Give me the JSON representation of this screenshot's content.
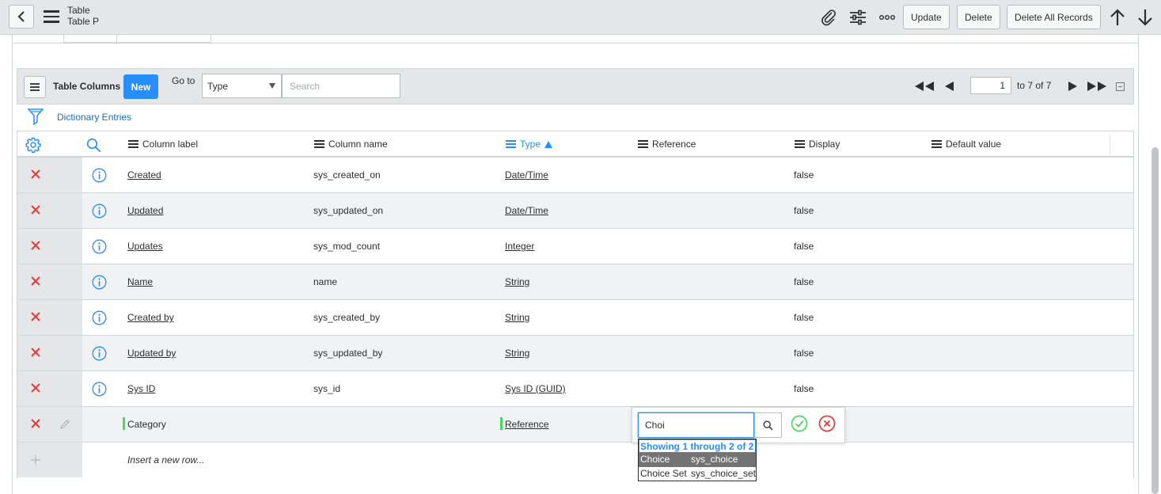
{
  "header": {
    "title": "Table",
    "subtitle": "Table P",
    "buttons": {
      "update": "Update",
      "delete": "Delete",
      "delete_all": "Delete All Records"
    },
    "icons": [
      "back-icon",
      "menu-icon",
      "attachment-icon",
      "settings-sliders-icon",
      "more-icon",
      "arrow-up-icon",
      "arrow-down-icon"
    ]
  },
  "list": {
    "title": "Table Columns",
    "new_label": "New",
    "goto_label": "Go to",
    "goto_field": "Type",
    "search_placeholder": "Search",
    "pager": {
      "current": "1",
      "total": "to 7 of 7"
    },
    "breadcrumb": "Dictionary Entries"
  },
  "columns": {
    "label": "Column label",
    "name": "Column name",
    "type": "Type",
    "reference": "Reference",
    "display": "Display",
    "default": "Default value"
  },
  "rows": [
    {
      "label": "Created",
      "name": "sys_created_on",
      "type": "Date/Time",
      "display": "false"
    },
    {
      "label": "Updated",
      "name": "sys_updated_on",
      "type": "Date/Time",
      "display": "false"
    },
    {
      "label": "Updates",
      "name": "sys_mod_count",
      "type": "Integer",
      "display": "false"
    },
    {
      "label": "Name",
      "name": "name",
      "type": "String",
      "display": "false"
    },
    {
      "label": "Created by",
      "name": "sys_created_by",
      "type": "String",
      "display": "false"
    },
    {
      "label": "Updated by",
      "name": "sys_updated_by",
      "type": "String",
      "display": "false"
    },
    {
      "label": "Sys ID",
      "name": "sys_id",
      "type": "Sys ID (GUID)",
      "display": "false"
    }
  ],
  "new_row": {
    "label": "Category",
    "type": "Reference"
  },
  "insert_row": "Insert a new row...",
  "editor": {
    "value": "Choi",
    "autocomplete": {
      "header": "Showing 1 through 2 of 2",
      "options": [
        {
          "label": "Choice",
          "value": "sys_choice"
        },
        {
          "label": "Choice Set",
          "value": "sys_choice_set"
        }
      ]
    }
  },
  "colors": {
    "accent": "#278efc",
    "delete": "#e53935",
    "edited": "#4bd762"
  }
}
